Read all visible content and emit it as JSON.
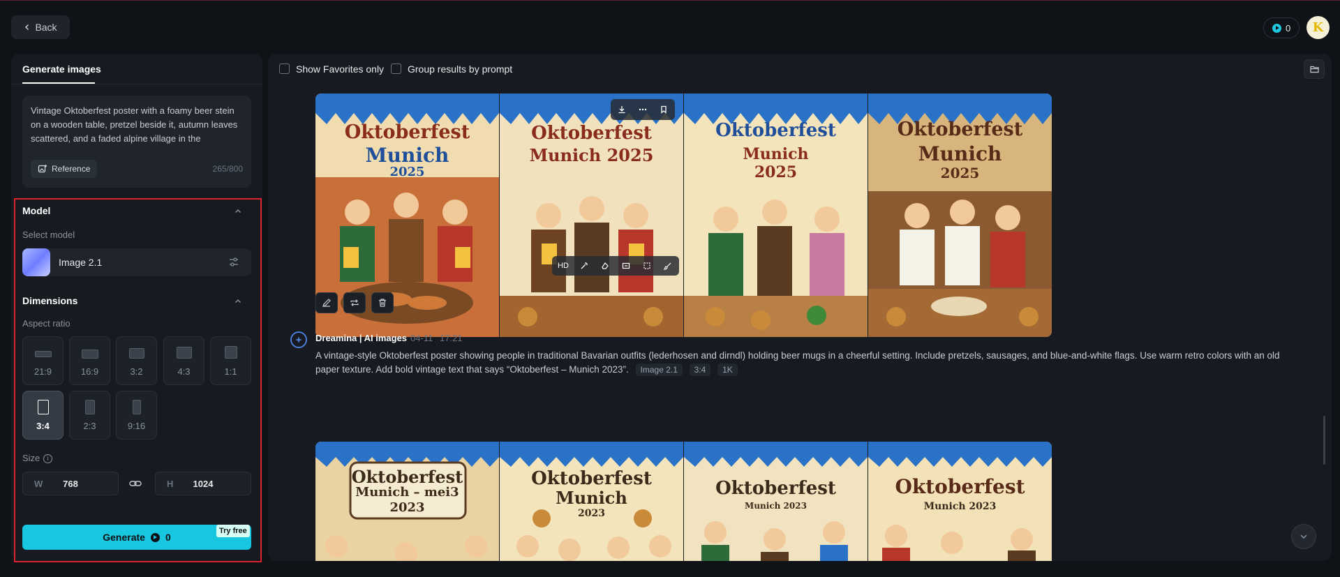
{
  "header": {
    "back_label": "Back",
    "credits": "0"
  },
  "left": {
    "tab_label": "Generate images",
    "prompt_text": "Vintage Oktoberfest poster with a foamy beer stein on a wooden table, pretzel beside it, autumn leaves scattered, and a faded alpine village in the background. Warm retro colors, old",
    "reference_label": "Reference",
    "char_count": "265/800",
    "model_section": "Model",
    "select_model_label": "Select model",
    "model_name": "Image 2.1",
    "dimensions_section": "Dimensions",
    "aspect_ratio_label": "Aspect ratio",
    "aspect_ratios": [
      "21:9",
      "16:9",
      "3:2",
      "4:3",
      "1:1",
      "3:4",
      "2:3",
      "9:16"
    ],
    "selected_aspect": "3:4",
    "size_label": "Size",
    "width_prefix": "W",
    "width_value": "768",
    "height_prefix": "H",
    "height_value": "1024",
    "generate_label": "Generate",
    "generate_cost": "0",
    "try_free": "Try free"
  },
  "right": {
    "show_favorites": "Show Favorites only",
    "group_by_prompt": "Group results by prompt",
    "hd_label": "HD",
    "batch1": {
      "posters": [
        {
          "title": "Oktoberfest",
          "sub": "Munich",
          "year": "2025"
        },
        {
          "title": "Oktoberfest",
          "sub": "Munich 2025",
          "year": ""
        },
        {
          "title": "Oktoberfest",
          "sub": "Munich",
          "year": "2025"
        },
        {
          "title": "Oktoberfest",
          "sub": "Munich",
          "year": "2025"
        }
      ]
    },
    "batch2": {
      "author": "Dreamina | AI images",
      "date": "04-11",
      "time": "17:21",
      "prompt": "A vintage-style Oktoberfest poster showing people in traditional Bavarian outfits (lederhosen and dirndl) holding beer mugs in a cheerful setting. Include pretzels, sausages, and blue-and-white flags. Use warm retro colors with an old paper texture. Add bold vintage text that says “Oktoberfest – Munich 2023”.",
      "tags": [
        "Image 2.1",
        "3:4",
        "1K"
      ],
      "posters": [
        {
          "title": "Oktoberfest",
          "sub": "Munich – mei3",
          "year": "2023"
        },
        {
          "title": "Oktoberfest",
          "sub": "Munich",
          "year": "2023"
        },
        {
          "title": "Oktoberfest",
          "sub": "Munich 2023",
          "year": ""
        },
        {
          "title": "Oktoberfest",
          "sub": "Munich 2023",
          "year": ""
        }
      ]
    }
  },
  "colors": {
    "accent": "#19c6df",
    "highlight_border": "#e0232f",
    "background": "#0f1216",
    "panel": "#171b21"
  }
}
